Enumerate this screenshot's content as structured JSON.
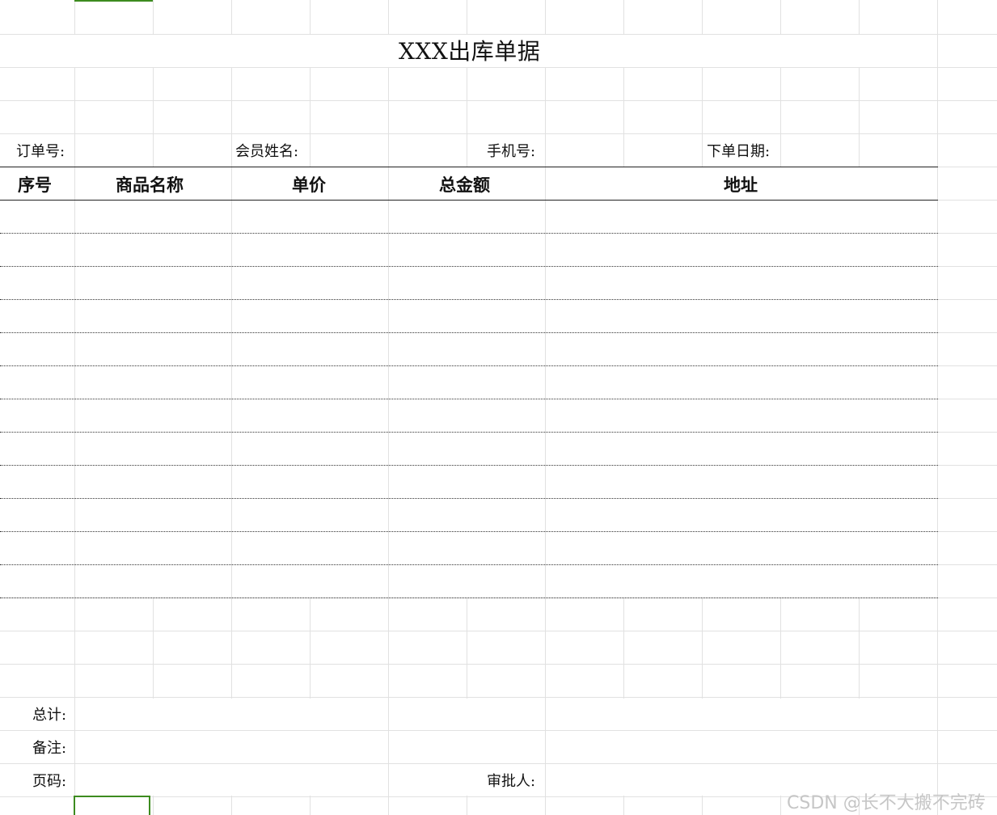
{
  "sheet": {
    "title": "XXX出库单据",
    "info_labels": {
      "order_no": "订单号:",
      "member_name": "会员姓名:",
      "phone": "手机号:",
      "order_date": "下单日期:"
    },
    "columns": [
      "序号",
      "商品名称",
      "单价",
      "总金额",
      "地址"
    ],
    "footer_labels": {
      "total": "总计:",
      "remark": "备注:",
      "page_no": "页码:",
      "approver": "审批人:"
    }
  },
  "watermark": "CSDN @长不大搬不完砖",
  "colors": {
    "grid": "#e1e1e1",
    "selection": "#3d8b1f",
    "border": "#222222"
  }
}
